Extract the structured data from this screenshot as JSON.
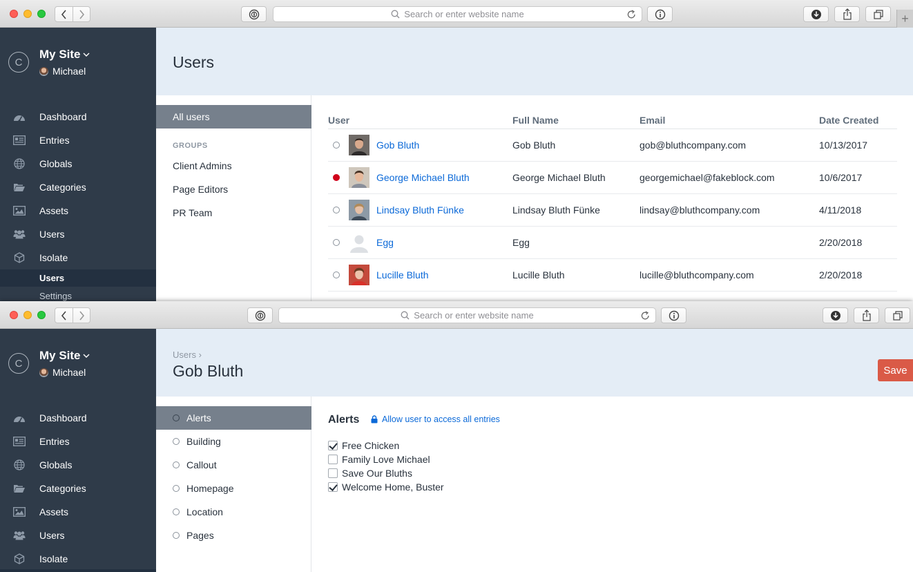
{
  "browser": {
    "url_placeholder": "Search or enter website name"
  },
  "sidebar": {
    "logo_letter": "C",
    "site_name": "My Site",
    "current_user": "Michael",
    "nav": [
      {
        "label": "Dashboard",
        "icon": "dashboard-icon"
      },
      {
        "label": "Entries",
        "icon": "entries-icon"
      },
      {
        "label": "Globals",
        "icon": "globe-icon"
      },
      {
        "label": "Categories",
        "icon": "folder-icon"
      },
      {
        "label": "Assets",
        "icon": "image-icon"
      },
      {
        "label": "Users",
        "icon": "users-icon"
      },
      {
        "label": "Isolate",
        "icon": "cube-icon"
      }
    ],
    "subnav": [
      {
        "label": "Users",
        "selected": true
      },
      {
        "label": "Settings",
        "selected": false
      }
    ]
  },
  "users_page": {
    "title": "Users",
    "all_users": "All users",
    "groups_heading": "GROUPS",
    "groups": [
      "Client Admins",
      "Page Editors",
      "PR Team"
    ],
    "columns": [
      "User",
      "Full Name",
      "Email",
      "Date Created"
    ],
    "rows": [
      {
        "user": "Gob Bluth",
        "full_name": "Gob Bluth",
        "email": "gob@bluthcompany.com",
        "date": "10/13/2017",
        "online": false
      },
      {
        "user": "George Michael Bluth",
        "full_name": "George Michael Bluth",
        "email": "georgemichael@fakeblock.com",
        "date": "10/6/2017",
        "online": true
      },
      {
        "user": "Lindsay Bluth Fünke",
        "full_name": "Lindsay Bluth Fünke",
        "email": "lindsay@bluthcompany.com",
        "date": "4/11/2018",
        "online": false
      },
      {
        "user": "Egg",
        "full_name": "Egg",
        "email": "",
        "date": "2/20/2018",
        "online": false
      },
      {
        "user": "Lucille Bluth",
        "full_name": "Lucille Bluth",
        "email": "lucille@bluthcompany.com",
        "date": "2/20/2018",
        "online": false
      }
    ]
  },
  "user_page": {
    "breadcrumb": "Users",
    "breadcrumb_sep": "›",
    "title": "Gob Bluth",
    "save_label": "Save",
    "tabs": [
      "Alerts",
      "Building",
      "Callout",
      "Homepage",
      "Location",
      "Pages"
    ],
    "selected_tab": "Alerts",
    "section_title": "Alerts",
    "allow_link": "Allow user to access all entries",
    "alerts": [
      {
        "label": "Free Chicken",
        "checked": true
      },
      {
        "label": "Family Love Michael",
        "checked": false
      },
      {
        "label": "Save Our Bluths",
        "checked": false
      },
      {
        "label": "Welcome Home, Buster",
        "checked": true
      }
    ]
  },
  "colors": {
    "sidebar_bg": "#2f3b49",
    "header_bg": "#e4edf6",
    "link": "#0b69d8",
    "save": "#da5a47",
    "online": "#d0021b",
    "selected_nav": "#76808c"
  }
}
